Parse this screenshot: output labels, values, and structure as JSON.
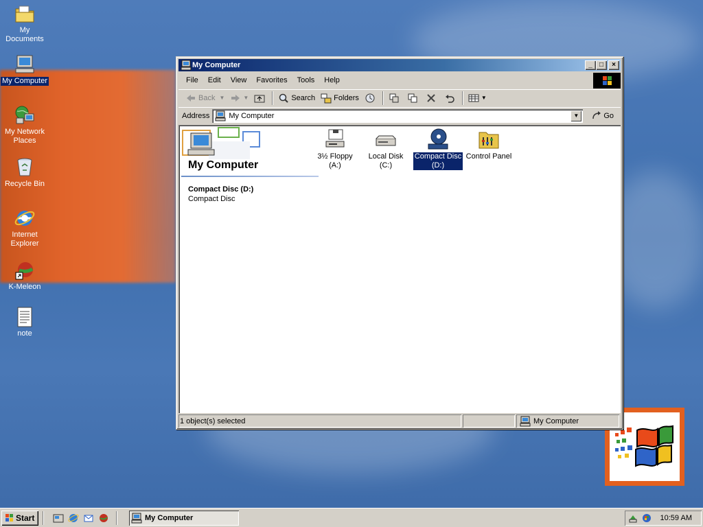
{
  "desktop": {
    "icons": [
      {
        "label": "My Documents",
        "icon": "folder-documents-icon"
      },
      {
        "label": "My Computer",
        "icon": "my-computer-icon"
      },
      {
        "label": "My Network Places",
        "icon": "network-places-icon"
      },
      {
        "label": "Recycle Bin",
        "icon": "recycle-bin-icon"
      },
      {
        "label": "Internet Explorer",
        "icon": "internet-explorer-icon"
      },
      {
        "label": "K-Meleon",
        "icon": "k-meleon-icon"
      },
      {
        "label": "note",
        "icon": "text-document-icon"
      }
    ],
    "selected_icon": "My Computer"
  },
  "window": {
    "title": "My Computer",
    "menu": [
      "File",
      "Edit",
      "View",
      "Favorites",
      "Tools",
      "Help"
    ],
    "toolbar": {
      "back": "Back",
      "search": "Search",
      "folders": "Folders"
    },
    "address": {
      "label": "Address",
      "value": "My Computer",
      "go": "Go"
    },
    "panel": {
      "title": "My Computer",
      "selected_name": "Compact Disc (D:)",
      "selected_type": "Compact Disc"
    },
    "items": [
      {
        "label": "3½ Floppy (A:)",
        "icon": "floppy-drive-icon"
      },
      {
        "label": "Local Disk (C:)",
        "icon": "hard-disk-icon"
      },
      {
        "label": "Compact Disc (D:)",
        "icon": "cd-drive-icon"
      },
      {
        "label": "Control Panel",
        "icon": "control-panel-icon"
      }
    ],
    "selected_item": "Compact Disc (D:)",
    "status": {
      "selection": "1 object(s) selected",
      "zone": "My Computer"
    }
  },
  "taskbar": {
    "start": "Start",
    "task": "My Computer",
    "clock": "10:59 AM"
  },
  "colors": {
    "desktop": "#3f6fae",
    "selection": "#0a246a",
    "face": "#d4d0c8",
    "accent_orange": "#e2601f"
  }
}
